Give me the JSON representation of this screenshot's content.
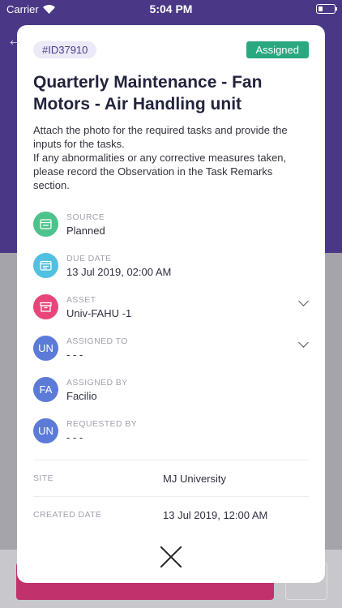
{
  "status": {
    "carrier": "Carrier",
    "time": "5:04 PM"
  },
  "task": {
    "id": "#ID37910",
    "status": "Assigned",
    "title": "Quarterly Maintenance - Fan Motors - Air Handling unit",
    "description": "Attach the photo for the required tasks and provide the inputs for the tasks.\nIf any abnormalities or any corrective measures taken, please record the Observation in the Task Remarks section."
  },
  "fields": [
    {
      "label": "SOURCE",
      "value": "Planned",
      "icon": "source-icon",
      "color": "#4cc38a"
    },
    {
      "label": "DUE DATE",
      "value": "13 Jul 2019, 02:00 AM",
      "icon": "calendar-icon",
      "color": "#52c0e0"
    },
    {
      "label": "ASSET",
      "value": "Univ-FAHU -1",
      "icon": "asset-icon",
      "color": "#e8457a"
    },
    {
      "label": "ASSIGNED TO",
      "value": "- - -",
      "initials": "UN",
      "color": "#5c7bd9"
    },
    {
      "label": "ASSIGNED BY",
      "value": "Facilio",
      "initials": "FA",
      "color": "#5c7bd9"
    },
    {
      "label": "REQUESTED BY",
      "value": "- - -",
      "initials": "UN",
      "color": "#5c7bd9"
    }
  ],
  "details": [
    {
      "label": "SITE",
      "value": "MJ University"
    },
    {
      "label": "CREATED DATE",
      "value": "13 Jul 2019, 12:00 AM"
    }
  ]
}
